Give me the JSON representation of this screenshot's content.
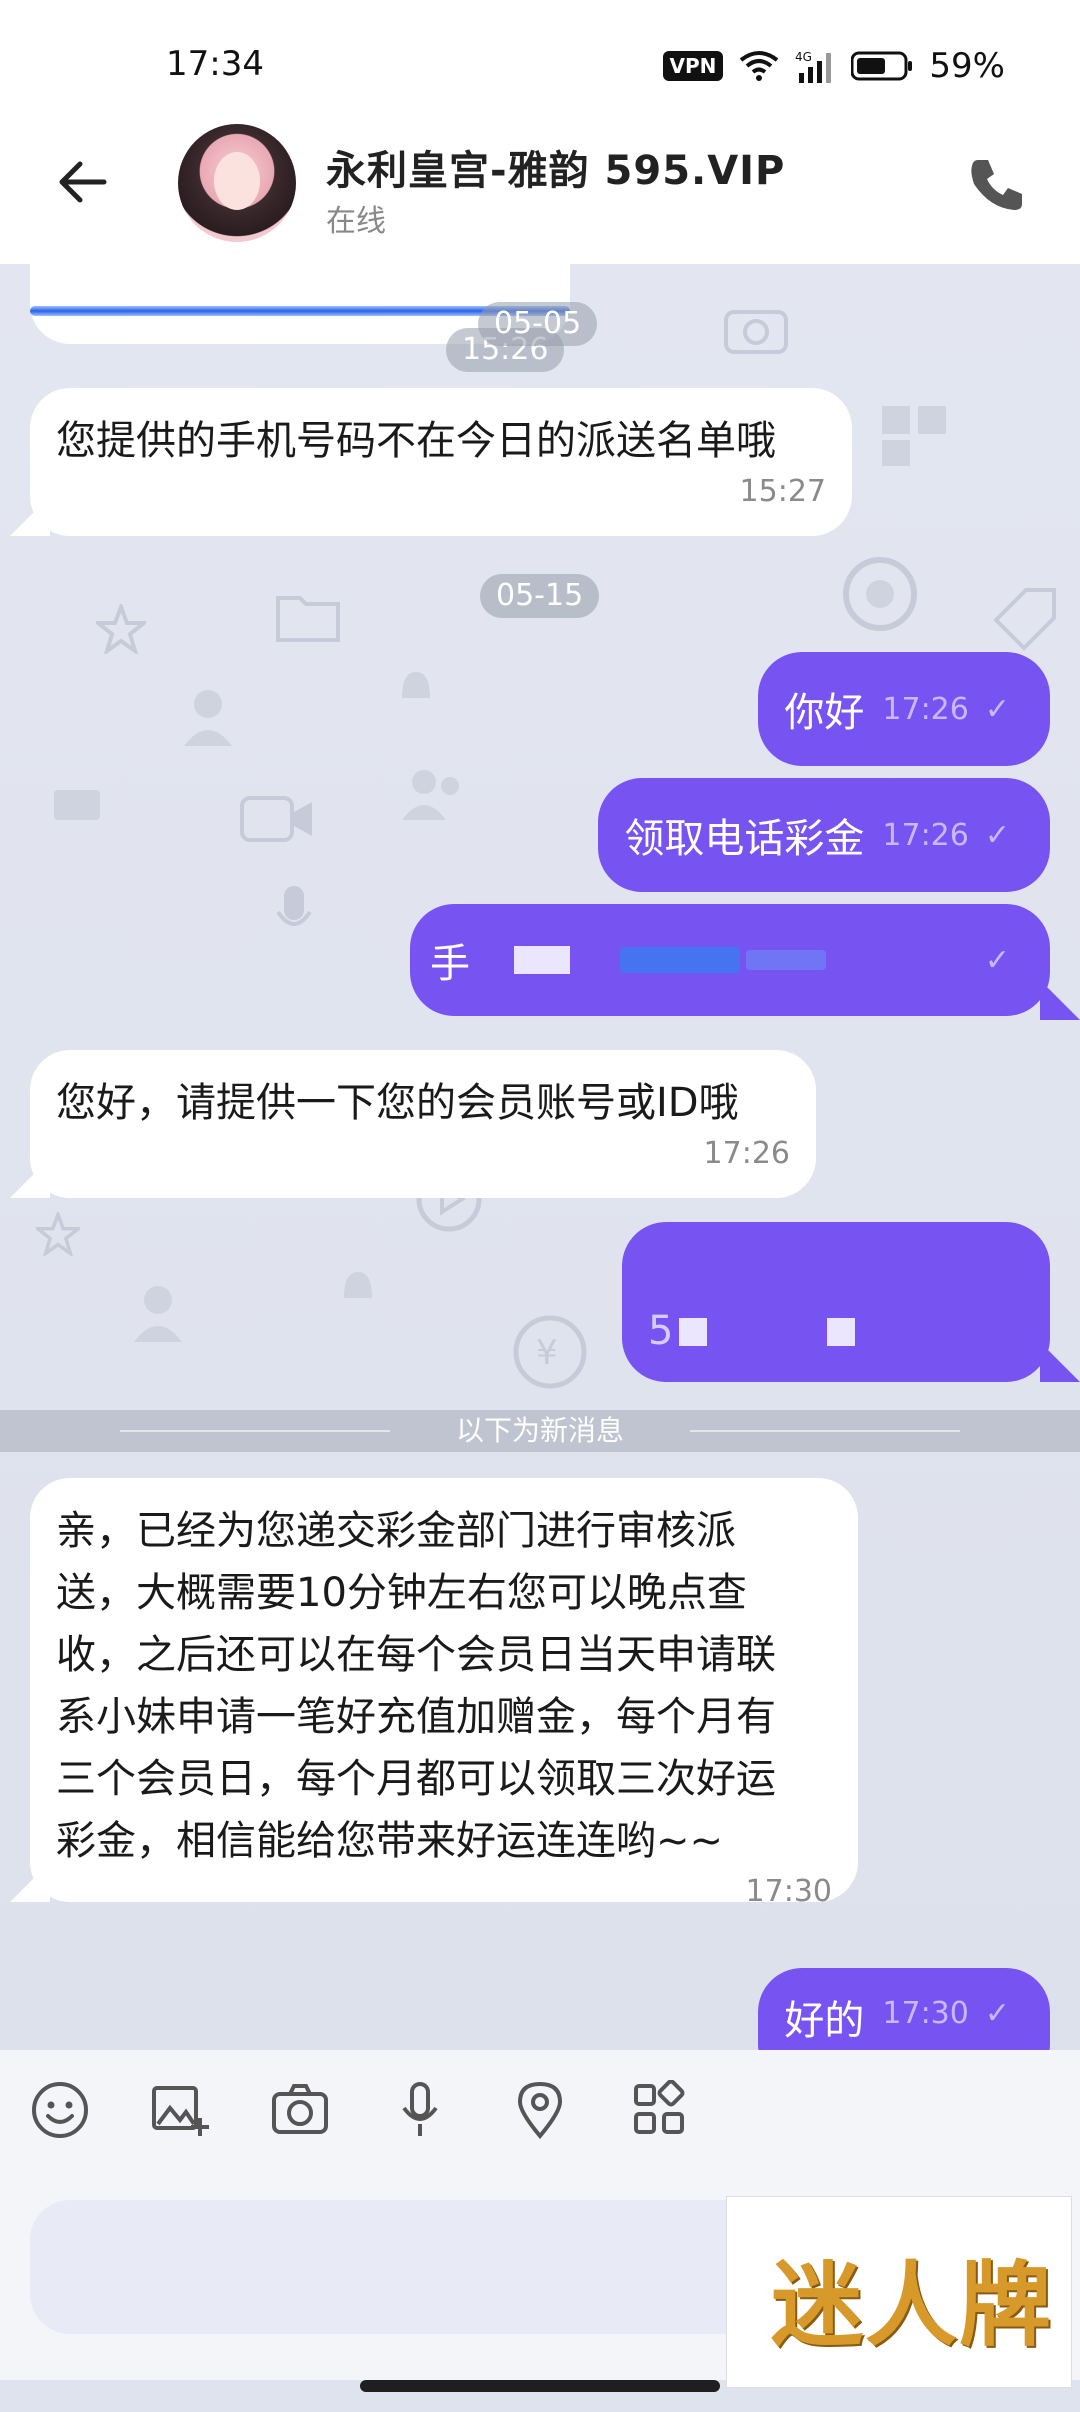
{
  "status_bar": {
    "time": "17:34",
    "vpn": "VPN",
    "network": "4G",
    "battery": "59%"
  },
  "header": {
    "contact_name": "永利皇宫-雅韵  595.VIP",
    "status": "在线"
  },
  "messages": {
    "partial_time": "15:26",
    "date_1": "05-05",
    "m1_text": "您提供的手机号码不在今日的派送名单哦",
    "m1_time": "15:27",
    "date_2": "05-15",
    "m2_text": "你好",
    "m2_time": "17:26",
    "m3_text": "领取电话彩金",
    "m3_time": "17:26",
    "m4_text": "手",
    "m5_text": "您好，请提供一下您的会员账号或ID哦",
    "m5_time": "17:26",
    "m6_text": "5",
    "new_messages_divider": "以下为新消息",
    "m7_lines": [
      "亲，已经为您递交彩金部门进行审核派",
      "送，大概需要10分钟左右您可以晚点查",
      "收，之后还可以在每个会员日当天申请联",
      "系小妹申请一笔好充值加赠金，每个月有",
      "三个会员日，每个月都可以领取三次好运",
      "彩金，相信能给您带来好运连连哟~~"
    ],
    "m7_time": "17:30",
    "m8_text": "好的",
    "m8_time": "17:30",
    "check": "✓"
  },
  "toolbar": {
    "icons": [
      "emoji-icon",
      "image-add-icon",
      "camera-icon",
      "mic-icon",
      "location-icon",
      "apps-icon"
    ]
  },
  "watermark": "迷人牌",
  "colors": {
    "outgoing": "#7754f2",
    "incoming": "#ffffff",
    "background": "#dfe3ee"
  }
}
